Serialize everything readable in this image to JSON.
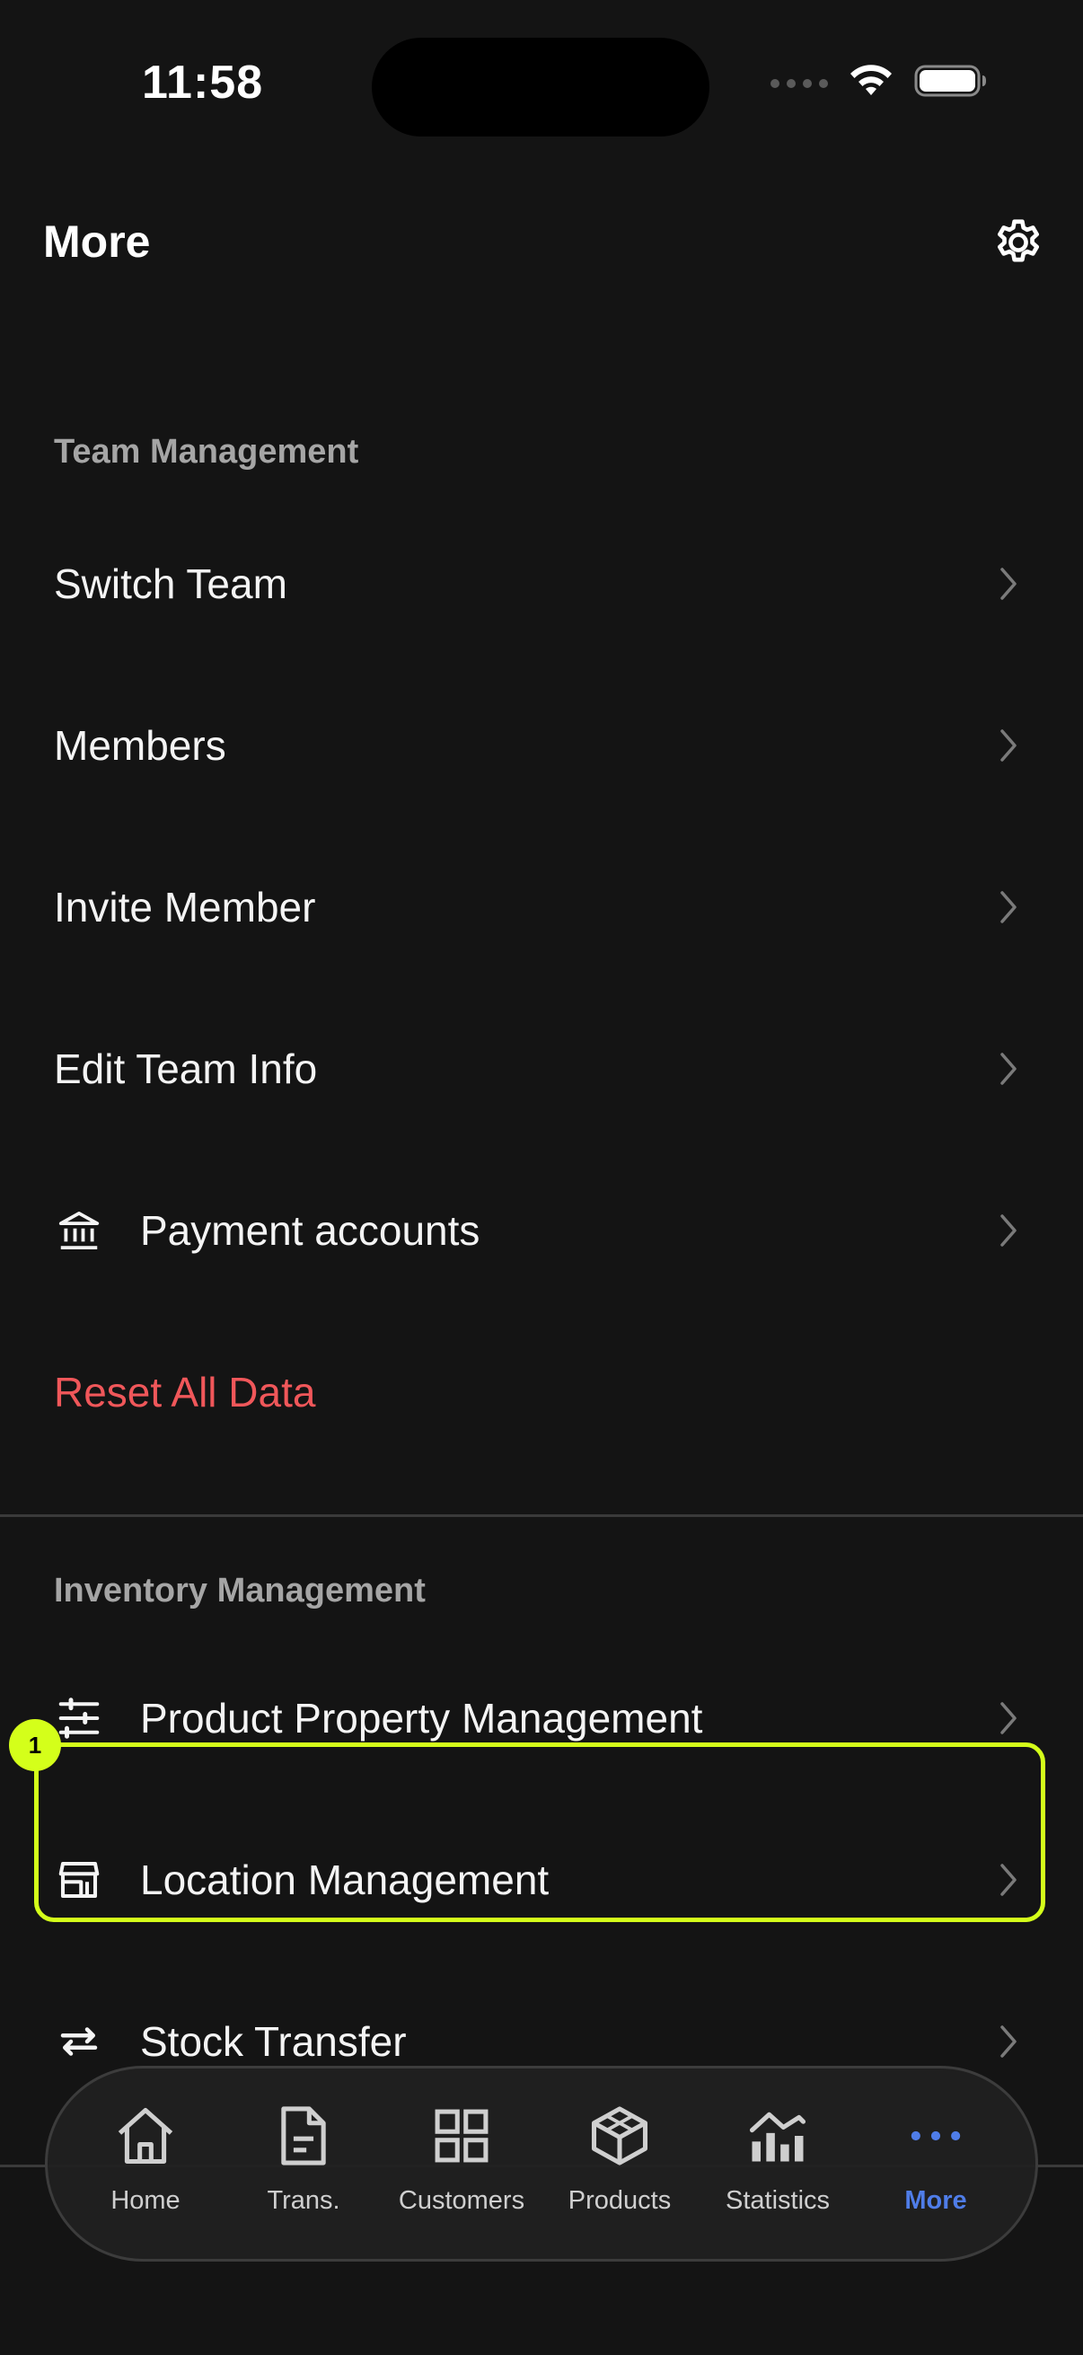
{
  "status_bar": {
    "time": "11:58"
  },
  "header": {
    "title": "More",
    "settings_icon": "gear-icon"
  },
  "team_management": {
    "header": "Team Management",
    "items": [
      {
        "label": "Switch Team"
      },
      {
        "label": "Members"
      },
      {
        "label": "Invite Member"
      },
      {
        "label": "Edit Team Info"
      },
      {
        "label": "Payment accounts",
        "icon": "bank-icon"
      }
    ],
    "reset_label": "Reset All Data"
  },
  "inventory_management": {
    "header": "Inventory Management",
    "items": [
      {
        "label": "Product Property Management",
        "icon": "sliders-icon"
      },
      {
        "label": "Location Management",
        "icon": "store-icon"
      },
      {
        "label": "Stock Transfer",
        "icon": "transfer-arrows-icon"
      }
    ]
  },
  "annotation": {
    "badge": "1"
  },
  "tab_bar": {
    "items": [
      {
        "label": "Home",
        "icon": "home-icon"
      },
      {
        "label": "Trans.",
        "icon": "document-icon"
      },
      {
        "label": "Customers",
        "icon": "grid-icon"
      },
      {
        "label": "Products",
        "icon": "cube-icon"
      },
      {
        "label": "Statistics",
        "icon": "chart-icon"
      },
      {
        "label": "More",
        "icon": "more-dots-icon",
        "active": true
      }
    ]
  },
  "colors": {
    "background": "#141414",
    "danger": "#f0575a",
    "accent": "#4f7de8",
    "highlight": "#d4ff1a",
    "section_header": "#a5a5a5"
  }
}
